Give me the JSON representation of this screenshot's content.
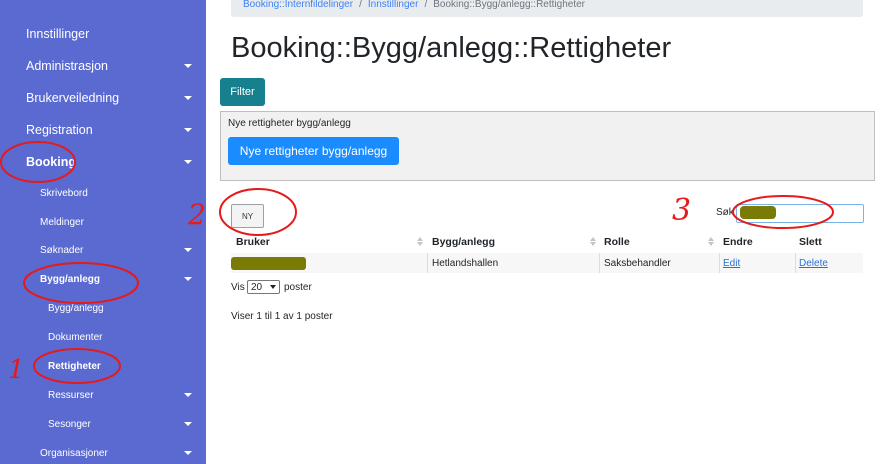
{
  "sidebar": {
    "items": [
      {
        "label": "Innstillinger",
        "caret": false
      },
      {
        "label": "Administrasjon",
        "caret": true
      },
      {
        "label": "Brukerveiledning",
        "caret": true
      },
      {
        "label": "Registration",
        "caret": true
      },
      {
        "label": "Booking",
        "caret": true
      },
      {
        "label": "Skrivebord",
        "caret": false
      },
      {
        "label": "Meldinger",
        "caret": false
      },
      {
        "label": "Søknader",
        "caret": true
      },
      {
        "label": "Bygg/anlegg",
        "caret": true
      },
      {
        "label": "Bygg/anlegg",
        "caret": false
      },
      {
        "label": "Dokumenter",
        "caret": false
      },
      {
        "label": "Rettigheter",
        "caret": false
      },
      {
        "label": "Ressurser",
        "caret": true
      },
      {
        "label": "Sesonger",
        "caret": true
      },
      {
        "label": "Organisasjoner",
        "caret": true
      }
    ]
  },
  "breadcrumb": {
    "items": [
      "Booking::Internfildelinger",
      "Innstillinger",
      "Booking::Bygg/anlegg::Rettigheter"
    ],
    "separator": "/"
  },
  "page_title": "Booking::Bygg/anlegg::Rettigheter",
  "filter_button": "Filter",
  "new_box": {
    "caption": "Nye rettigheter bygg/anlegg",
    "button": "Nye rettigheter bygg/anlegg"
  },
  "ny_button": "NY",
  "search": {
    "label": "Søk",
    "value": ""
  },
  "table": {
    "columns": [
      "Bruker",
      "Bygg/anlegg",
      "Rolle",
      "Endre",
      "Slett"
    ],
    "rows": [
      {
        "bruker": "",
        "bygg": "Hetlandshallen",
        "rolle": "Saksbehandler",
        "endre": "Edit",
        "slett": "Delete"
      }
    ]
  },
  "length": {
    "prefix": "Vis",
    "value": "20",
    "suffix": "poster"
  },
  "info": "Viser 1 til 1 av 1 poster",
  "annotations": [
    "1",
    "2",
    "3"
  ],
  "colors": {
    "sidebar": "#5a6ad0",
    "filter_button": "#17808f",
    "primary_button": "#1a8cff",
    "annotation": "#e61a1a",
    "redaction": "#7a7a06"
  }
}
